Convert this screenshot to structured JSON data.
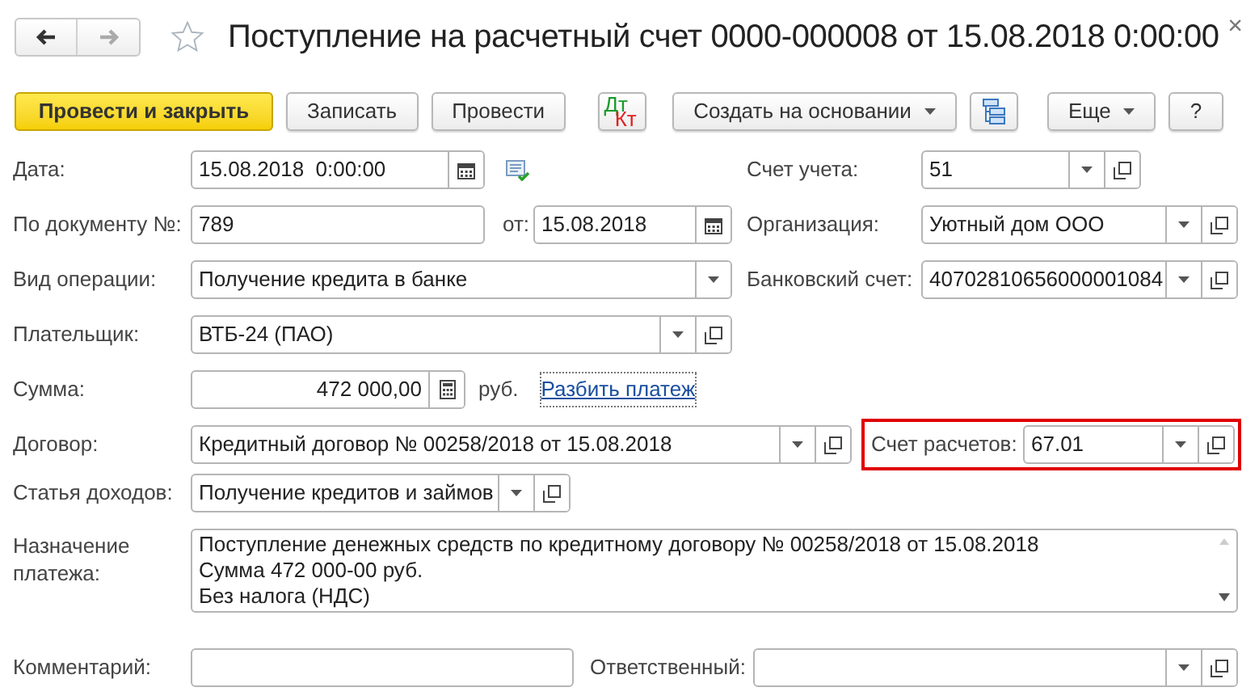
{
  "header": {
    "nav": [
      {
        "kind": "back",
        "disabled": false
      },
      {
        "kind": "forward",
        "disabled": true
      }
    ],
    "favorite": false,
    "title": "Поступление на расчетный счет 0000-000008 от 15.08.2018 0:00:00",
    "close": "×"
  },
  "toolbar": [
    {
      "kind": "primary",
      "label": "Провести и закрыть"
    },
    {
      "kind": "plain",
      "label": "Записать"
    },
    {
      "kind": "plain",
      "label": "Провести"
    },
    {
      "kind": "dtkt",
      "debit": "Дт",
      "credit": "Кт"
    },
    {
      "kind": "menu",
      "label": "Создать на основании"
    },
    {
      "kind": "structure"
    },
    {
      "kind": "menu",
      "label": "Еще"
    },
    {
      "kind": "plain",
      "label": "?"
    }
  ],
  "form": {
    "date": {
      "label": "Дата:",
      "value": "15.08.2018  0:00:00",
      "kind": "date"
    },
    "account": {
      "label": "Счет учета:",
      "value": "51",
      "kind": "reference"
    },
    "doc_number": {
      "label": "По документу №:",
      "value": "789"
    },
    "doc_date": {
      "label": "от:",
      "value": "15.08.2018",
      "kind": "date"
    },
    "organization": {
      "label": "Организация:",
      "value": "Уютный дом ООО",
      "kind": "reference"
    },
    "operation": {
      "label": "Вид операции:",
      "value": "Получение кредита в банке",
      "kind": "select"
    },
    "bank_account": {
      "label": "Банковский счет:",
      "value": "40702810656000001084",
      "kind": "reference"
    },
    "payer": {
      "label": "Плательщик:",
      "value": "ВТБ-24 (ПАО)",
      "kind": "reference"
    },
    "amount": {
      "label": "Сумма:",
      "value": "472 000,00",
      "kind": "amount",
      "currency": "руб.",
      "link": "Разбить платеж"
    },
    "contract": {
      "label": "Договор:",
      "value": "Кредитный договор № 00258/2018 от 15.08.2018",
      "kind": "reference"
    },
    "settlement_account": {
      "label": "Счет расчетов:",
      "value": "67.01",
      "kind": "reference",
      "highlighted": true
    },
    "income_item": {
      "label": "Статья доходов:",
      "value": "Получение кредитов и займов",
      "kind": "reference"
    },
    "purpose": {
      "label": "Назначение платежа:",
      "lines": [
        "Поступление денежных средств по кредитному договору № 00258/2018 от 15.08.2018",
        "Сумма 472 000-00 руб.",
        "Без налога (НДС)"
      ]
    },
    "comment": {
      "label": "Комментарий:"
    },
    "responsible": {
      "label": "Ответственный:",
      "kind": "reference"
    }
  }
}
